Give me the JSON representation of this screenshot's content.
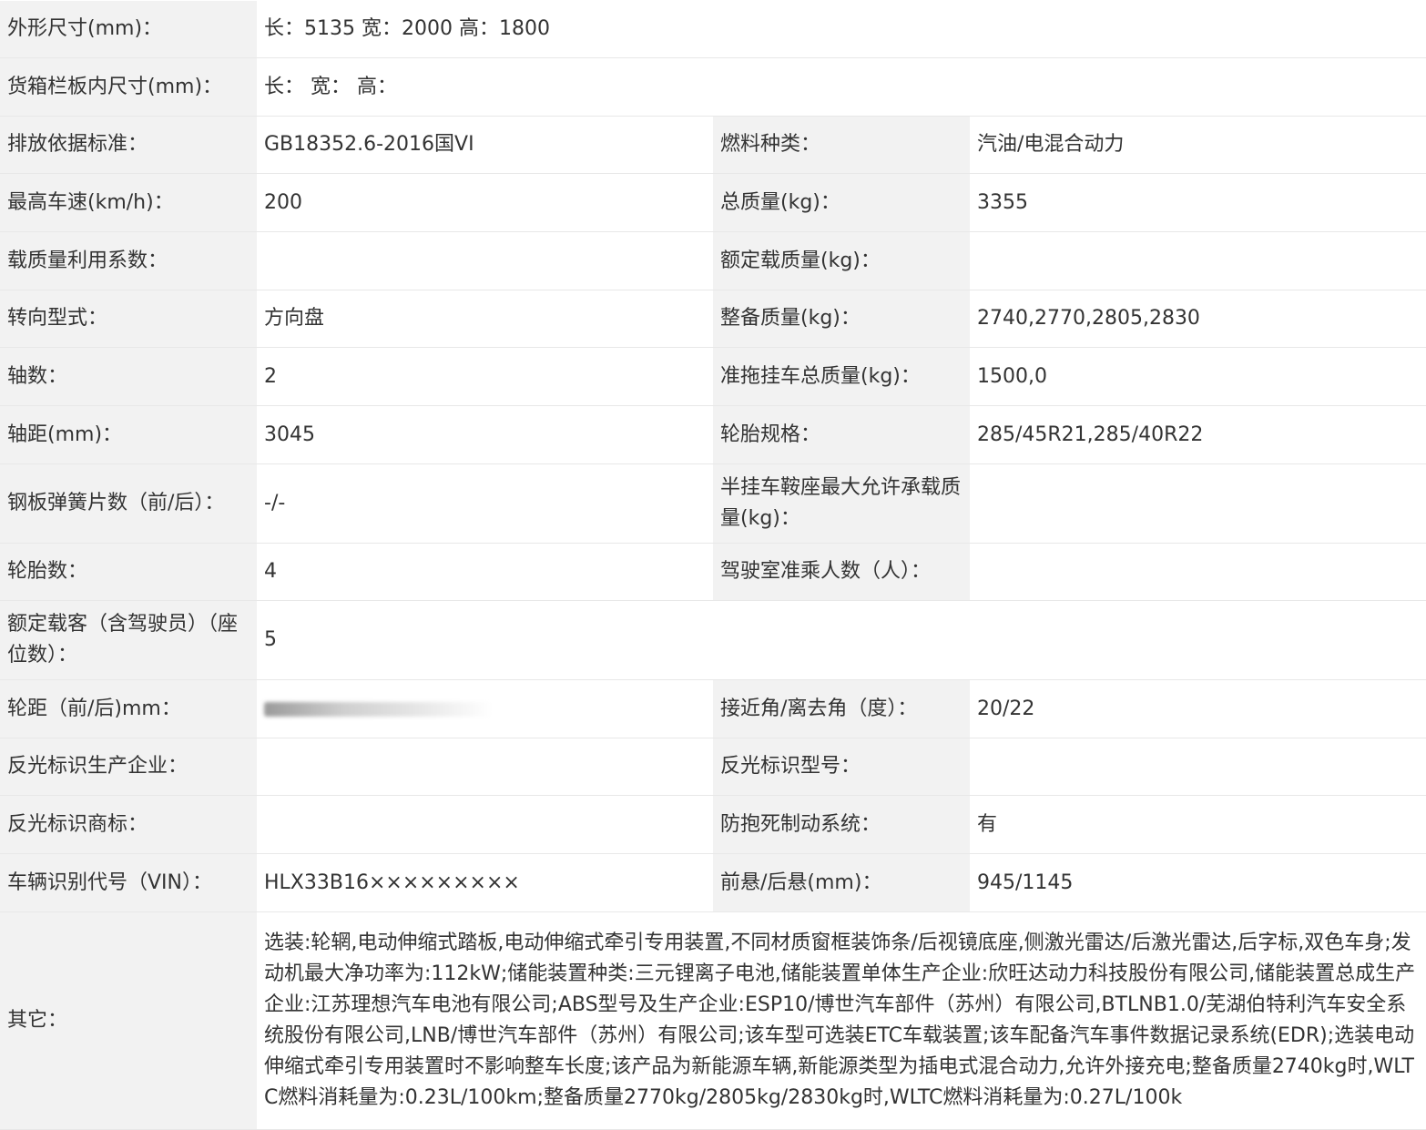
{
  "rows": {
    "dims": {
      "label": "外形尺寸(mm)：",
      "value": "长：5135 宽：2000 高：1800"
    },
    "cargo": {
      "label": "货箱栏板内尺寸(mm)：",
      "value": "长： 宽： 高："
    },
    "emission": {
      "label": "排放依据标准：",
      "value": "GB18352.6-2016国VI",
      "label2": "燃料种类：",
      "value2": "汽油/电混合动力"
    },
    "speed": {
      "label": "最高车速(km/h)：",
      "value": "200",
      "label2": "总质量(kg)：",
      "value2": "3355"
    },
    "load_coef": {
      "label": "载质量利用系数：",
      "value": "",
      "label2": "额定载质量(kg)：",
      "value2": ""
    },
    "steering": {
      "label": "转向型式：",
      "value": "方向盘",
      "label2": "整备质量(kg)：",
      "value2": "2740,2770,2805,2830"
    },
    "axles": {
      "label": "轴数：",
      "value": "2",
      "label2": "准拖挂车总质量(kg)：",
      "value2": "1500,0"
    },
    "wheelbase": {
      "label": "轴距(mm)：",
      "value": "3045",
      "label2": "轮胎规格：",
      "value2": "285/45R21,285/40R22"
    },
    "springs": {
      "label": "钢板弹簧片数（前/后）：",
      "value": "-/-",
      "label2": "半挂车鞍座最大允许承载质量(kg)：",
      "value2": ""
    },
    "tires": {
      "label": "轮胎数：",
      "value": "4",
      "label2": "驾驶室准乘人数（人）：",
      "value2": ""
    },
    "passengers": {
      "label": "额定载客（含驾驶员）（座位数）：",
      "value": "5"
    },
    "track": {
      "label": "轮距（前/后)mm：",
      "value": "",
      "label2": "接近角/离去角（度）：",
      "value2": "20/22"
    },
    "reflector_maker": {
      "label": "反光标识生产企业：",
      "value": "",
      "label2": "反光标识型号：",
      "value2": ""
    },
    "reflector_brand": {
      "label": "反光标识商标：",
      "value": "",
      "label2": "防抱死制动系统：",
      "value2": "有"
    },
    "vin": {
      "label": "车辆识别代号（VIN）：",
      "value": "HLX33B16×××××××××",
      "label2": "前悬/后悬(mm)：",
      "value2": "945/1145"
    },
    "other": {
      "label": "其它：",
      "value": "选装:轮辋,电动伸缩式踏板,电动伸缩式牵引专用装置,不同材质窗框装饰条/后视镜底座,侧激光雷达/后激光雷达,后字标,双色车身;发动机最大净功率为:112kW;储能装置种类:三元锂离子电池,储能装置单体生产企业:欣旺达动力科技股份有限公司,储能装置总成生产企业:江苏理想汽车电池有限公司;ABS型号及生产企业:ESP10/博世汽车部件（苏州）有限公司,BTLNB1.0/芜湖伯特利汽车安全系统股份有限公司,LNB/博世汽车部件（苏州）有限公司;该车型可选装ETC车载装置;该车配备汽车事件数据记录系统(EDR);选装电动伸缩式牵引专用装置时不影响整车长度;该产品为新能源车辆,新能源类型为插电式混合动力,允许外接充电;整备质量2740kg时,WLTC燃料消耗量为:0.23L/100km;整备质量2770kg/2805kg/2830kg时,WLTC燃料消耗量为:0.27L/100k"
    }
  }
}
